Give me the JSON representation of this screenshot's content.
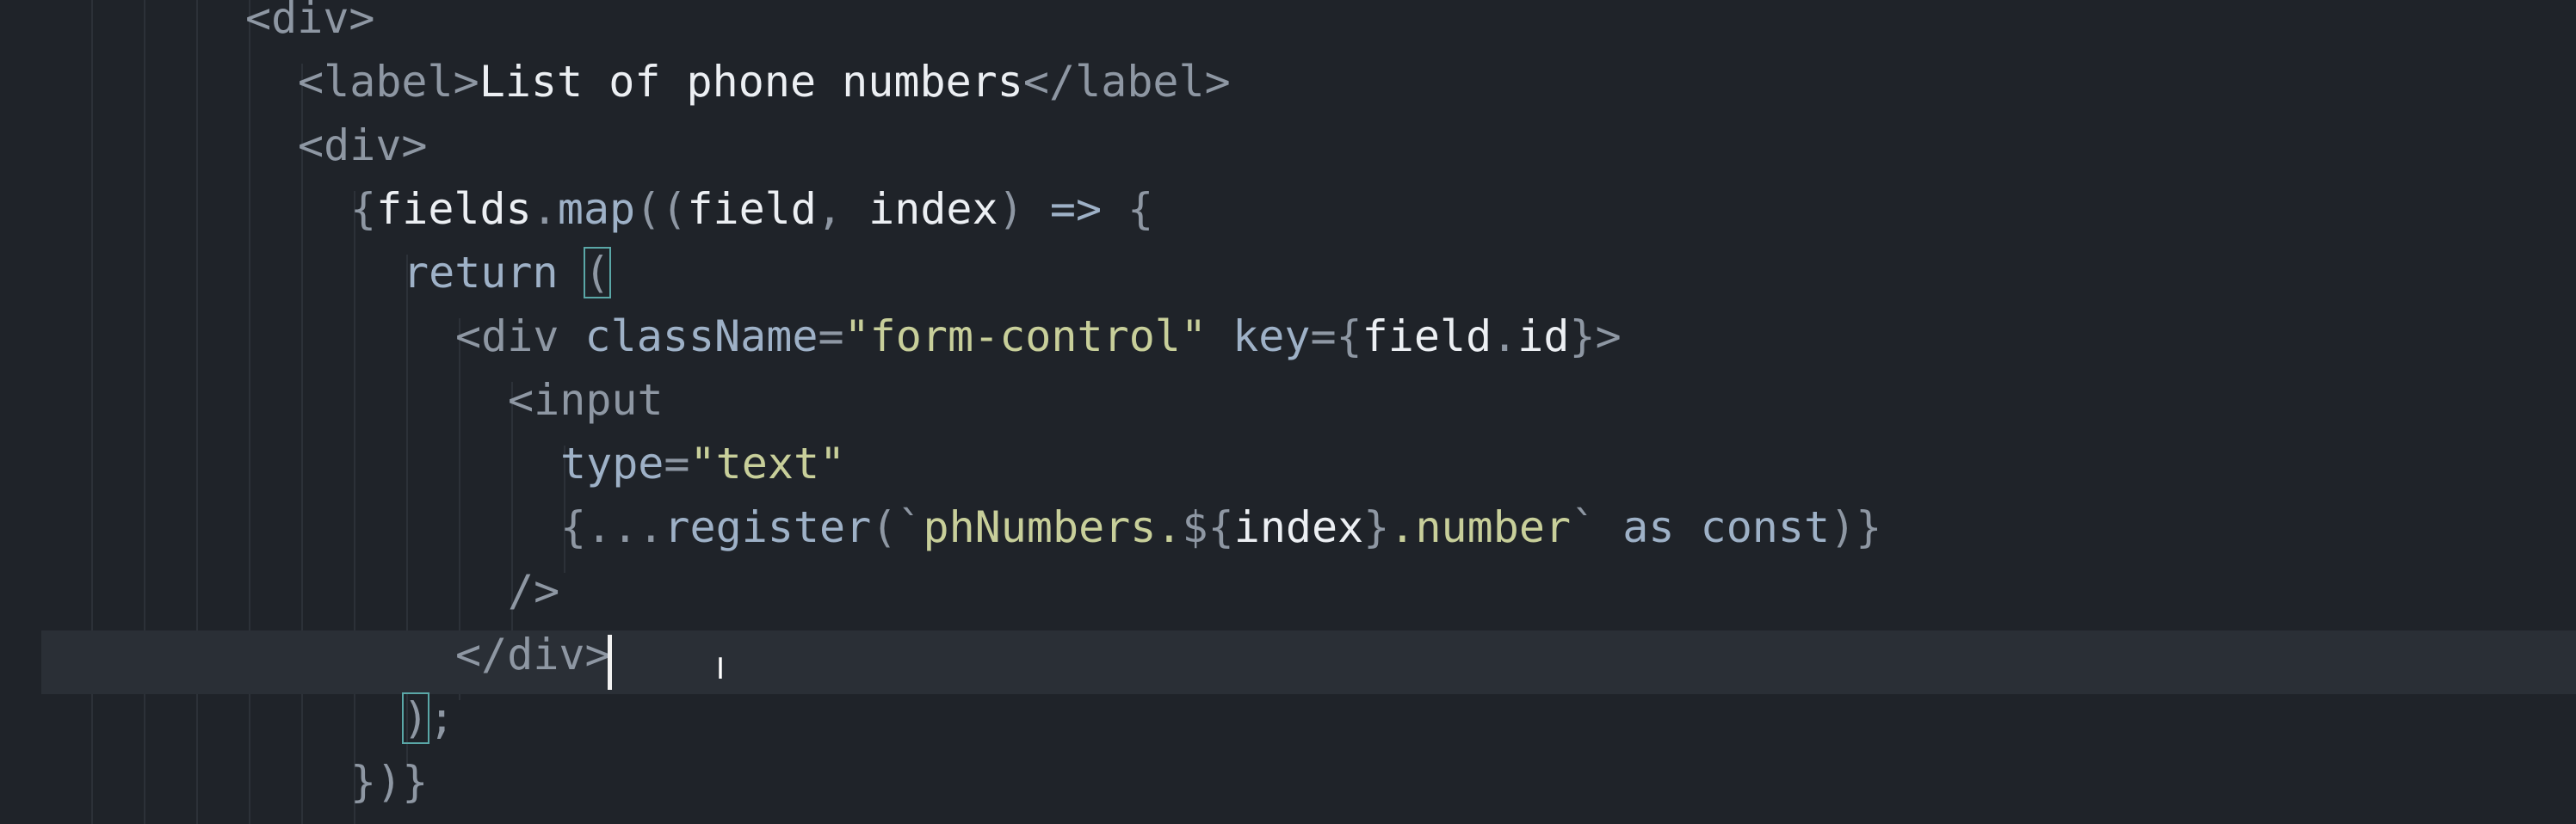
{
  "editor": {
    "lines": [
      {
        "indent": 0,
        "parts": [
          [
            "p",
            "<"
          ],
          [
            "t",
            "div"
          ],
          [
            "p",
            ">"
          ]
        ]
      },
      {
        "indent": 1,
        "parts": [
          [
            "p",
            "<"
          ],
          [
            "t",
            "label"
          ],
          [
            "p",
            ">"
          ],
          [
            "w",
            "List of phone numbers"
          ],
          [
            "p",
            "</"
          ],
          [
            "t",
            "label"
          ],
          [
            "p",
            ">"
          ]
        ]
      },
      {
        "indent": 1,
        "parts": [
          [
            "p",
            "<"
          ],
          [
            "t",
            "div"
          ],
          [
            "p",
            ">"
          ]
        ]
      },
      {
        "indent": 2,
        "parts": [
          [
            "p",
            "{"
          ],
          [
            "w",
            "fields"
          ],
          [
            "p",
            "."
          ],
          [
            "a",
            "map"
          ],
          [
            "p",
            "(("
          ],
          [
            "w",
            "field"
          ],
          [
            "p",
            ", "
          ],
          [
            "w",
            "index"
          ],
          [
            "p",
            ") "
          ],
          [
            "k",
            "=>"
          ],
          [
            "p",
            " {"
          ]
        ]
      },
      {
        "indent": 3,
        "parts": [
          [
            "k",
            "return"
          ],
          [
            "p",
            " "
          ],
          [
            "p",
            "("
          ]
        ]
      },
      {
        "indent": 4,
        "parts": [
          [
            "p",
            "<"
          ],
          [
            "t",
            "div"
          ],
          [
            "p",
            " "
          ],
          [
            "a",
            "className"
          ],
          [
            "p",
            "="
          ],
          [
            "s",
            "\"form-control\""
          ],
          [
            "p",
            " "
          ],
          [
            "a",
            "key"
          ],
          [
            "p",
            "={"
          ],
          [
            "w",
            "field"
          ],
          [
            "p",
            "."
          ],
          [
            "w",
            "id"
          ],
          [
            "p",
            "}>"
          ]
        ]
      },
      {
        "indent": 5,
        "parts": [
          [
            "p",
            "<"
          ],
          [
            "t",
            "input"
          ]
        ]
      },
      {
        "indent": 6,
        "parts": [
          [
            "a",
            "type"
          ],
          [
            "p",
            "="
          ],
          [
            "s",
            "\"text\""
          ]
        ]
      },
      {
        "indent": 6,
        "parts": [
          [
            "p",
            "{..."
          ],
          [
            "a",
            "register"
          ],
          [
            "p",
            "(`"
          ],
          [
            "s",
            "phNumbers."
          ],
          [
            "p",
            "${"
          ],
          [
            "w",
            "index"
          ],
          [
            "p",
            "}"
          ],
          [
            "s",
            ".number"
          ],
          [
            "p",
            "`"
          ],
          [
            "p",
            " "
          ],
          [
            "k",
            "as const"
          ],
          [
            "p",
            ")}"
          ]
        ]
      },
      {
        "indent": 5,
        "parts": [
          [
            "p",
            "/>"
          ]
        ]
      },
      {
        "indent": 4,
        "parts": [
          [
            "p",
            "</"
          ],
          [
            "t",
            "div"
          ],
          [
            "p",
            ">"
          ]
        ]
      },
      {
        "indent": 3,
        "parts": [
          [
            "p",
            ")"
          ],
          [
            "p",
            ";"
          ]
        ]
      },
      {
        "indent": 2,
        "parts": [
          [
            "p",
            "})"
          ],
          [
            "p",
            "}"
          ]
        ]
      }
    ]
  },
  "colors": {
    "background": "#1f2329",
    "current_line": "#2a2f36",
    "punctuation": "#8e97a3",
    "attribute": "#9eb1c7",
    "string": "#c8cf9a",
    "text": "#eceff3",
    "bracket_match": "#5aa7a7"
  }
}
